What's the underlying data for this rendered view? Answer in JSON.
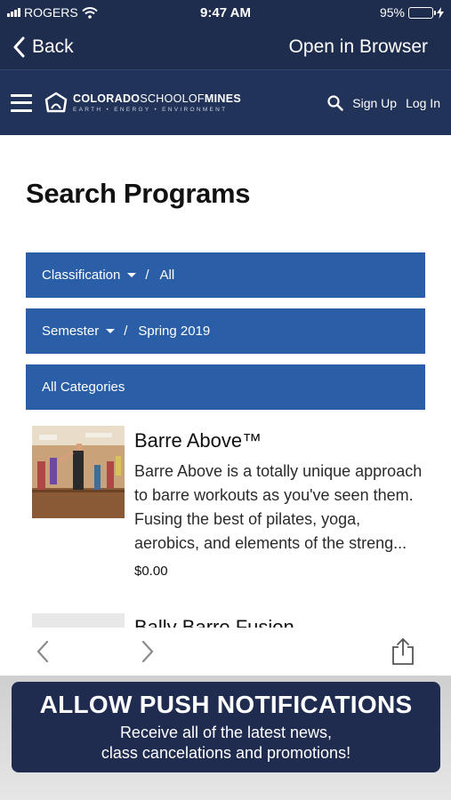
{
  "status_bar": {
    "carrier": "ROGERS",
    "time": "9:47 AM",
    "battery": "95%",
    "battery_level": 0.95
  },
  "nav": {
    "back_label": "Back",
    "open_label": "Open in Browser"
  },
  "site": {
    "logo_bold_1": "COLORADO",
    "logo_light": "SCHOOLOF",
    "logo_bold_2": "MINES",
    "logo_tagline": "EARTH • ENERGY • ENVIRONMENT",
    "signup_label": "Sign Up",
    "login_label": "Log In"
  },
  "page": {
    "title": "Search Programs"
  },
  "filters": [
    {
      "label": "Classification",
      "value": "All",
      "sep": "/"
    },
    {
      "label": "Semester",
      "value": "Spring 2019",
      "sep": "/"
    },
    {
      "label": "All Categories"
    }
  ],
  "programs": [
    {
      "title": "Barre Above™",
      "description": "Barre Above is a totally unique approach to barre workouts as you've seen them. Fusing the best of pilates, yoga, aerobics, and elements of the streng...",
      "price": "$0.00"
    },
    {
      "title": "Bally Barre Fusion"
    }
  ],
  "banner": {
    "title": "ALLOW PUSH NOTIFICATIONS",
    "line1": "Receive all of the latest news,",
    "line2": "class cancelations and promotions!"
  },
  "colors": {
    "navy": "#1e2c4d",
    "header": "#22335a",
    "filter_blue": "#2a5ea6",
    "battery_green": "#4cd964"
  }
}
